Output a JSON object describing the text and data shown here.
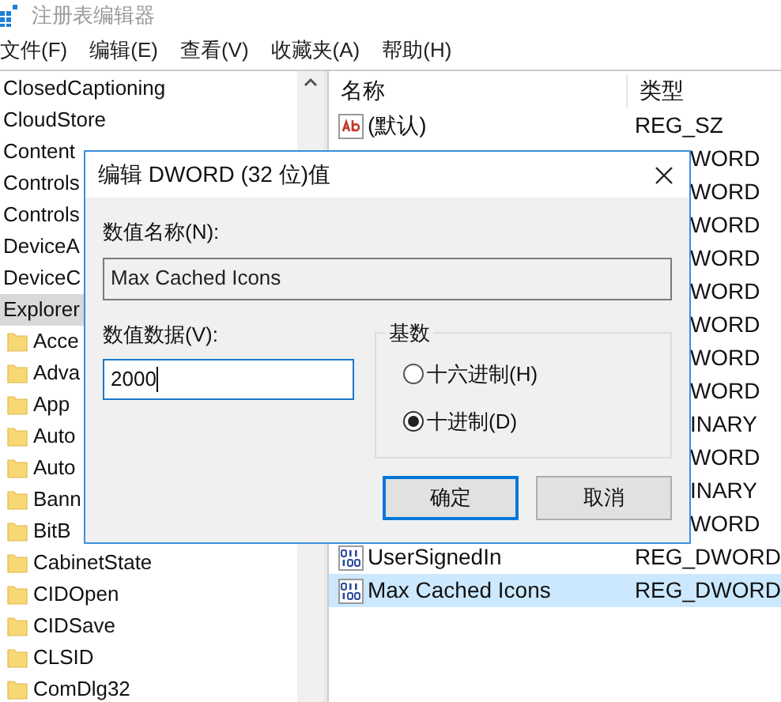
{
  "window": {
    "title": "注册表编辑器"
  },
  "menu": [
    "文件(F)",
    "编辑(E)",
    "查看(V)",
    "收藏夹(A)",
    "帮助(H)"
  ],
  "tree": [
    {
      "label": "ClosedCaptioning",
      "selected": false
    },
    {
      "label": "CloudStore",
      "selected": false
    },
    {
      "label": "Content",
      "selected": false
    },
    {
      "label": "Controls",
      "selected": false
    },
    {
      "label": "Controls",
      "selected": false
    },
    {
      "label": "DeviceA",
      "selected": false
    },
    {
      "label": "DeviceC",
      "selected": false
    },
    {
      "label": "Explorer",
      "selected": true,
      "children": [
        {
          "label": "Acce",
          "selected": false
        },
        {
          "label": "Adva",
          "selected": false
        },
        {
          "label": "App",
          "selected": false
        },
        {
          "label": "Auto",
          "selected": false
        },
        {
          "label": "Auto",
          "selected": false
        },
        {
          "label": "Bann",
          "selected": false
        },
        {
          "label": "BitB",
          "selected": false
        },
        {
          "label": "CabinetState",
          "selected": false
        },
        {
          "label": "CIDOpen",
          "selected": false
        },
        {
          "label": "CIDSave",
          "selected": false
        },
        {
          "label": "CLSID",
          "selected": false
        },
        {
          "label": "ComDlg32",
          "selected": false
        }
      ]
    }
  ],
  "list": {
    "columns": [
      "名称",
      "类型"
    ],
    "rows": [
      {
        "name": "(默认)",
        "kind": "string",
        "type": "REG_SZ",
        "selected": false
      },
      {
        "type": "WORD",
        "selected": false
      },
      {
        "type": "WORD",
        "selected": false
      },
      {
        "type": "WORD",
        "selected": false
      },
      {
        "type": "WORD",
        "selected": false
      },
      {
        "type": "WORD",
        "selected": false
      },
      {
        "type": "WORD",
        "selected": false
      },
      {
        "type": "WORD",
        "selected": false
      },
      {
        "type": "WORD",
        "selected": false
      },
      {
        "type": "INARY",
        "selected": false
      },
      {
        "type": "WORD",
        "selected": false
      },
      {
        "type": "INARY",
        "selected": false
      },
      {
        "type": "WORD",
        "selected": false
      },
      {
        "name": "UserSignedIn",
        "kind": "binary",
        "type": "REG_DWORD",
        "selected": false
      },
      {
        "name": "Max Cached Icons",
        "kind": "binary",
        "type": "REG_DWORD",
        "selected": true
      }
    ]
  },
  "dialog": {
    "title": "编辑 DWORD (32 位)值",
    "name_label": "数值名称(N):",
    "name_value": "Max Cached Icons",
    "data_label": "数值数据(V):",
    "data_value": "2000",
    "base_label": "基数",
    "bases": [
      {
        "label": "十六进制(H)",
        "selected": false
      },
      {
        "label": "十进制(D)",
        "selected": true
      }
    ],
    "buttons": [
      {
        "label": "确定",
        "default": true
      },
      {
        "label": "取消",
        "default": false
      }
    ]
  }
}
